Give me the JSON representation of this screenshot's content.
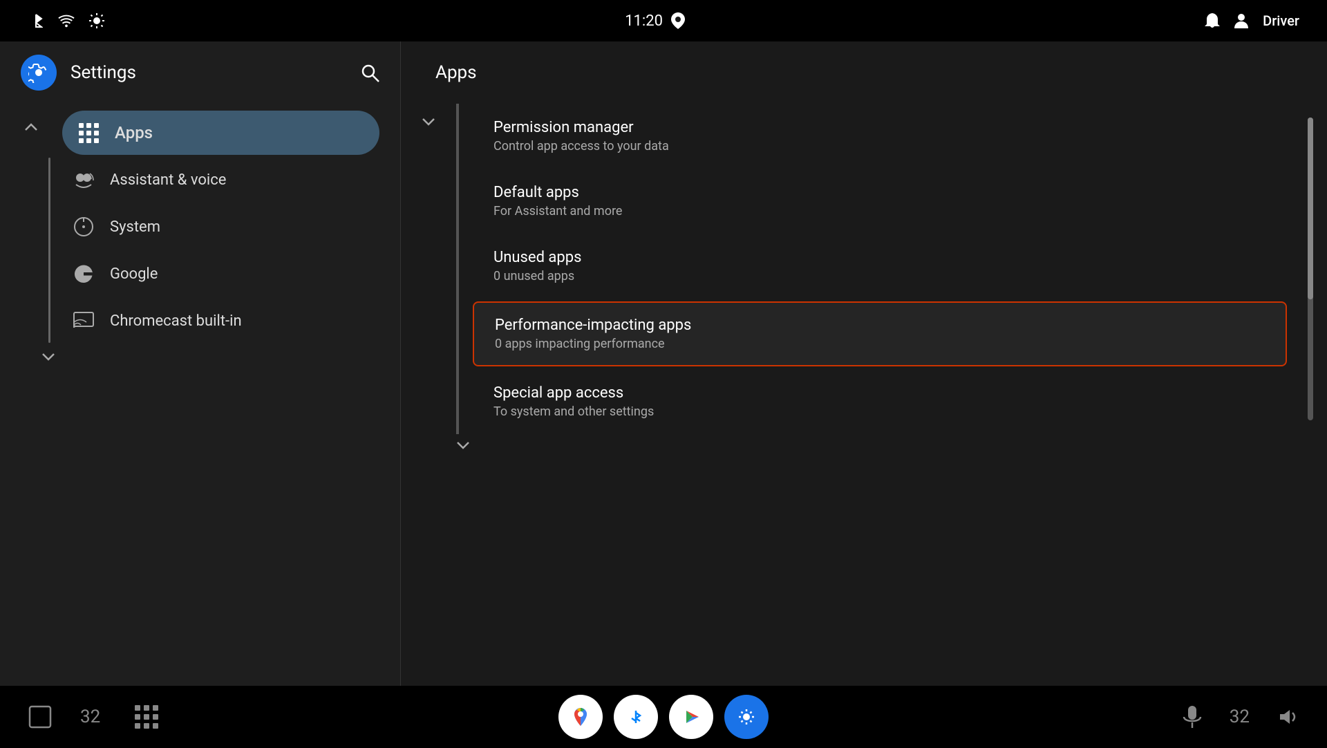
{
  "statusBar": {
    "time": "11:20",
    "driverLabel": "Driver"
  },
  "sidebar": {
    "title": "Settings",
    "searchLabel": "Search",
    "items": [
      {
        "id": "apps",
        "label": "Apps",
        "active": true
      },
      {
        "id": "assistant-voice",
        "label": "Assistant & voice",
        "active": false
      },
      {
        "id": "system",
        "label": "System",
        "active": false
      },
      {
        "id": "google",
        "label": "Google",
        "active": false
      },
      {
        "id": "chromecast",
        "label": "Chromecast built-in",
        "active": false
      }
    ],
    "expandLabel": "expand",
    "collapseLabel": "collapse"
  },
  "rightPanel": {
    "title": "Apps",
    "items": [
      {
        "id": "permission-manager",
        "title": "Permission manager",
        "subtitle": "Control app access to your data"
      },
      {
        "id": "default-apps",
        "title": "Default apps",
        "subtitle": "For Assistant and more"
      },
      {
        "id": "unused-apps",
        "title": "Unused apps",
        "subtitle": "0 unused apps"
      },
      {
        "id": "performance-impacting-apps",
        "title": "Performance-impacting apps",
        "subtitle": "0 apps impacting performance",
        "selected": true
      },
      {
        "id": "special-app-access",
        "title": "Special app access",
        "subtitle": "To system and other settings"
      }
    ]
  },
  "bottomBar": {
    "leftNumber": "32",
    "rightNumber": "32"
  }
}
